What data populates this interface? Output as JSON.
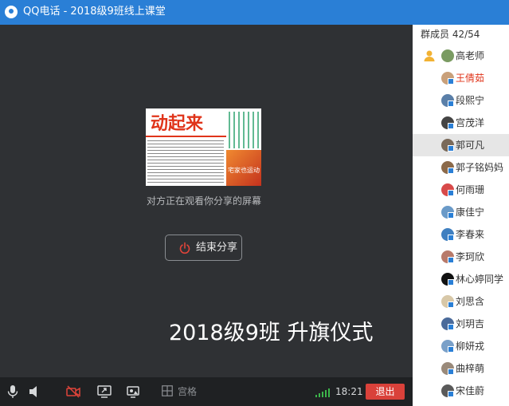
{
  "window": {
    "title": "QQ电话 - 2018级9班线上课堂"
  },
  "stage": {
    "thumbnail": {
      "headline": "动起来",
      "photo_caption": "宅家也运动"
    },
    "share_status": "对方正在观看你分享的屏幕",
    "stop_share_label": "结束分享",
    "overlay_text": "2018级9班 升旗仪式"
  },
  "toolbar": {
    "grid_label": "宫格",
    "time": "18:21",
    "exit_label": "退出"
  },
  "sidebar": {
    "header": "群成员 42/54",
    "members": [
      {
        "name": "高老师",
        "owner": true,
        "color": "#7a9b62"
      },
      {
        "name": "王倩茹",
        "highlight": true,
        "color": "#c9a07a"
      },
      {
        "name": "段熙宁",
        "color": "#5a7fa8"
      },
      {
        "name": "宫茂洋",
        "color": "#444444"
      },
      {
        "name": "郭可凡",
        "selected": true,
        "color": "#7a6a5a"
      },
      {
        "name": "郭子铭妈妈",
        "color": "#8c6a4a"
      },
      {
        "name": "何雨珊",
        "color": "#d84a4a"
      },
      {
        "name": "康佳宁",
        "color": "#6a9ac8"
      },
      {
        "name": "李春来",
        "color": "#3f7fc0"
      },
      {
        "name": "李珂欣",
        "color": "#b87a6a"
      },
      {
        "name": "林心婷同学",
        "color": "#111111"
      },
      {
        "name": "刘思含",
        "color": "#d8c8a8"
      },
      {
        "name": "刘玥吉",
        "color": "#4a6a9a"
      },
      {
        "name": "柳妍戎",
        "color": "#7aa0c8"
      },
      {
        "name": "曲梓萌",
        "color": "#9a8a7a"
      },
      {
        "name": "宋佳蔚",
        "color": "#5a5a5a"
      }
    ]
  },
  "colors": {
    "accent": "#2a7fd6",
    "exit": "#d9413a",
    "highlight_name": "#e0341a"
  }
}
